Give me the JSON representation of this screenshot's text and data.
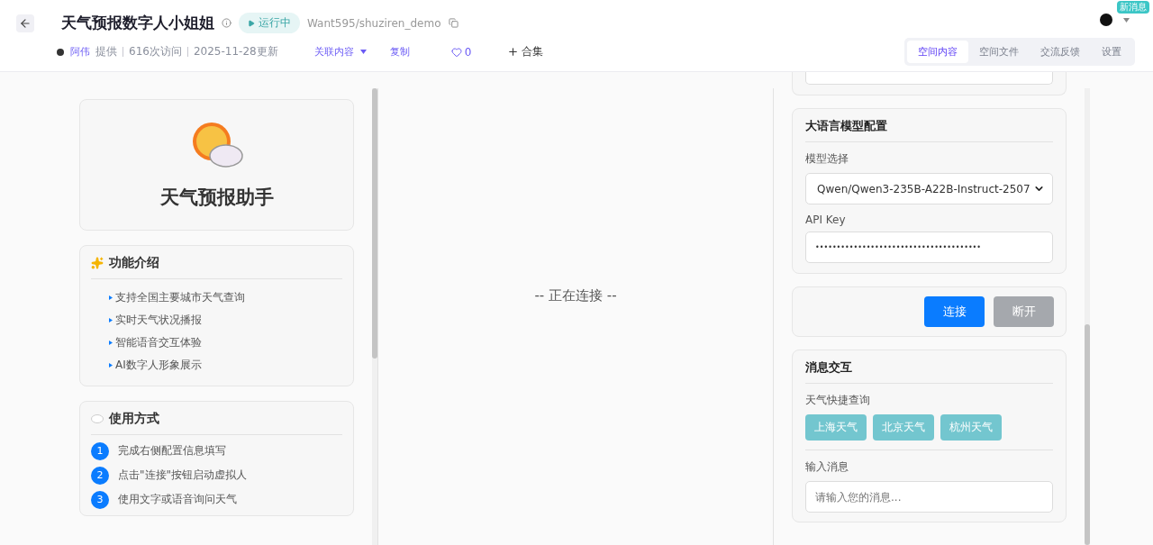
{
  "header": {
    "title": "天气预报数字人小姐姐",
    "status": "运行中",
    "repo": "Want595/shuziren_demo",
    "author": "阿伟",
    "provided": "提供",
    "visits": "616次访问",
    "updated": "2025-11-28更新",
    "related": "关联内容",
    "copy": "复制",
    "likes": "0",
    "collection": "合集",
    "badge": "新消息"
  },
  "tabs": [
    {
      "label": "空间内容",
      "selected": true
    },
    {
      "label": "空间文件",
      "selected": false
    },
    {
      "label": "交流反馈",
      "selected": false
    },
    {
      "label": "设置",
      "selected": false
    }
  ],
  "hero": {
    "title": "天气预报助手"
  },
  "features": {
    "title": "功能介绍",
    "items": [
      "支持全国主要城市天气查询",
      "实时天气状况播报",
      "智能语音交互体验",
      "AI数字人形象展示"
    ]
  },
  "usage": {
    "title": "使用方式",
    "steps": [
      {
        "number": "1",
        "text": "完成右侧配置信息填写"
      },
      {
        "number": "2",
        "text": "点击\"连接\"按钮启动虚拟人"
      },
      {
        "number": "3",
        "text": "使用文字或语音询问天气"
      }
    ]
  },
  "stage": {
    "status": "-- 正在连接 --"
  },
  "llm": {
    "title": "大语言模型配置",
    "model_label": "模型选择",
    "model_value": "Qwen/Qwen3-235B-A22B-Instruct-2507",
    "key_label": "API Key",
    "key_value": "•••••••••••••••••••••••••••••••••••••••"
  },
  "actions": [
    {
      "label": "连接",
      "disabled": false
    },
    {
      "label": "断开",
      "disabled": true
    }
  ],
  "messages": {
    "title": "消息交互",
    "quick_label": "天气快捷查询",
    "quick": [
      "上海天气",
      "北京天气",
      "杭州天气"
    ],
    "input_label": "输入消息",
    "placeholder": "请输入您的消息..."
  }
}
